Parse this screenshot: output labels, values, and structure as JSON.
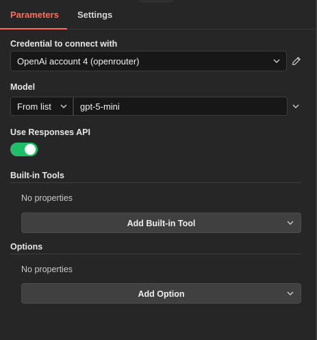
{
  "tabs": [
    {
      "label": "Parameters",
      "active": true
    },
    {
      "label": "Settings",
      "active": false
    }
  ],
  "credential": {
    "label": "Credential to connect with",
    "value": "OpenAi account 4 (openrouter)"
  },
  "model": {
    "label": "Model",
    "mode": "From list",
    "value": "gpt-5-mini"
  },
  "responses_api": {
    "label": "Use Responses API",
    "enabled": true
  },
  "builtin_tools": {
    "title": "Built-in Tools",
    "empty_text": "No properties",
    "add_label": "Add Built-in Tool"
  },
  "options": {
    "title": "Options",
    "empty_text": "No properties",
    "add_label": "Add Option"
  },
  "colors": {
    "accent": "#ff6d5a",
    "toggle_on": "#1fbf6a",
    "background": "#262626"
  }
}
